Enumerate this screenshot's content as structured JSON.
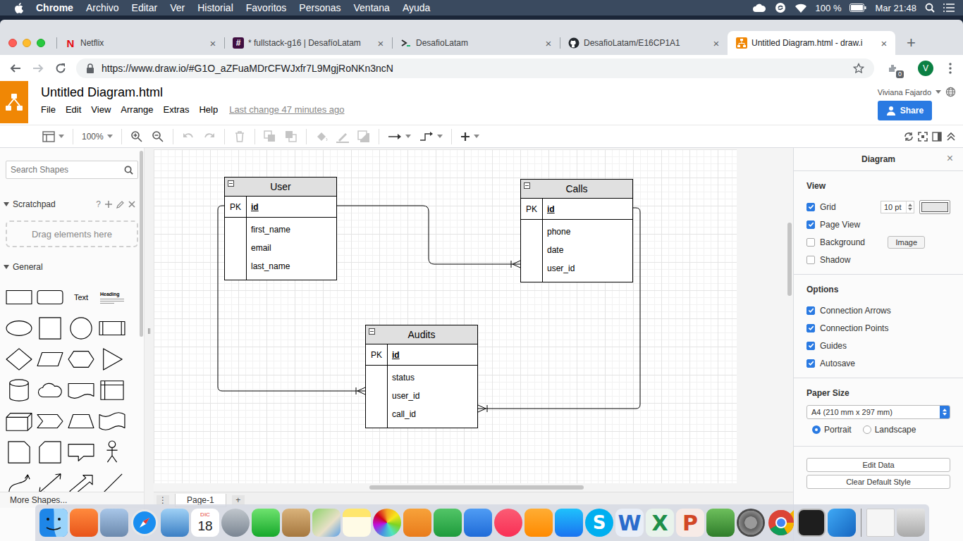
{
  "menubar": {
    "app": "Chrome",
    "menus": [
      "Archivo",
      "Editar",
      "Ver",
      "Historial",
      "Favoritos",
      "Personas",
      "Ventana",
      "Ayuda"
    ],
    "battery": "100 %",
    "clock": "Mar 21:48"
  },
  "browser": {
    "tabs": [
      {
        "label": "Netflix",
        "favicon": "N",
        "kind": "netflix",
        "selected": false
      },
      {
        "label": "* fullstack-g16 | DesafíoLatam",
        "favicon": "#",
        "kind": "slack",
        "selected": false
      },
      {
        "label": "DesafioLatam",
        "kind": "desafio",
        "selected": false
      },
      {
        "label": "DesafioLatam/E16CP1A1",
        "kind": "github",
        "selected": false
      },
      {
        "label": "Untitled Diagram.html - draw.i",
        "kind": "drawio",
        "selected": true
      }
    ],
    "tab_close": "×",
    "new_tab": "+",
    "url": "https://www.draw.io/#G1O_aZFuaMDrCFWJxfr7L9MgjRoNKn3ncN",
    "extension_badge": "0",
    "avatar": "V"
  },
  "drawio": {
    "title": "Untitled Diagram.html",
    "menus": [
      "File",
      "Edit",
      "View",
      "Arrange",
      "Extras",
      "Help"
    ],
    "last_change": "Last change 47 minutes ago",
    "user": "Viviana Fajardo",
    "share": "Share",
    "zoom": "100%"
  },
  "sidebar": {
    "search_placeholder": "Search Shapes",
    "scratchpad": {
      "title": "Scratchpad",
      "help": "?",
      "drop_hint": "Drag elements here"
    },
    "section": {
      "title": "General",
      "expanded": true
    },
    "shape_labels": {
      "text": "Text",
      "heading": "Heading"
    },
    "more": "More Shapes..."
  },
  "diagram": {
    "entities": [
      {
        "name": "User",
        "key": {
          "tag": "PK",
          "name": "id"
        },
        "fields": [
          "first_name",
          "email",
          "last_name"
        ]
      },
      {
        "name": "Calls",
        "key": {
          "tag": "PK",
          "name": "id"
        },
        "fields": [
          "phone",
          "date",
          "user_id"
        ]
      },
      {
        "name": "Audits",
        "key": {
          "tag": "PK",
          "name": "id"
        },
        "fields": [
          "status",
          "user_id",
          "call_id"
        ]
      }
    ],
    "connections": [
      {
        "from": "User",
        "to": "Calls",
        "to_field": "user_id",
        "end": "many"
      },
      {
        "from": "User",
        "to": "Audits",
        "to_field": "user_id",
        "end": "many"
      },
      {
        "from": "Calls",
        "to": "Audits",
        "to_field": "call_id",
        "end": "many"
      }
    ]
  },
  "format_panel": {
    "title": "Diagram",
    "close": "×",
    "view": {
      "heading": "View",
      "rows": [
        {
          "label": "Grid",
          "checked": true,
          "kind": "size",
          "value": "10 pt"
        },
        {
          "label": "Page View",
          "checked": true,
          "kind": "plain"
        },
        {
          "label": "Background",
          "checked": false,
          "kind": "button",
          "button": "Image"
        },
        {
          "label": "Shadow",
          "checked": false,
          "kind": "plain"
        }
      ]
    },
    "options": {
      "heading": "Options",
      "rows": [
        {
          "label": "Connection Arrows",
          "checked": true
        },
        {
          "label": "Connection Points",
          "checked": true
        },
        {
          "label": "Guides",
          "checked": true
        },
        {
          "label": "Autosave",
          "checked": true
        }
      ]
    },
    "paper": {
      "heading": "Paper Size",
      "value": "A4 (210 mm x 297 mm)",
      "orientations": [
        {
          "label": "Portrait",
          "selected": true
        },
        {
          "label": "Landscape",
          "selected": false
        }
      ]
    },
    "buttons": [
      "Edit Data",
      "Clear Default Style"
    ]
  },
  "pages": {
    "menu": "⋮",
    "tabs": [
      {
        "label": "Page-1",
        "selected": true
      }
    ],
    "add": "+"
  },
  "dock": {
    "calendar": {
      "month": "DIC",
      "day": "18"
    },
    "letters": [
      "S",
      "W",
      "X",
      "P"
    ]
  }
}
